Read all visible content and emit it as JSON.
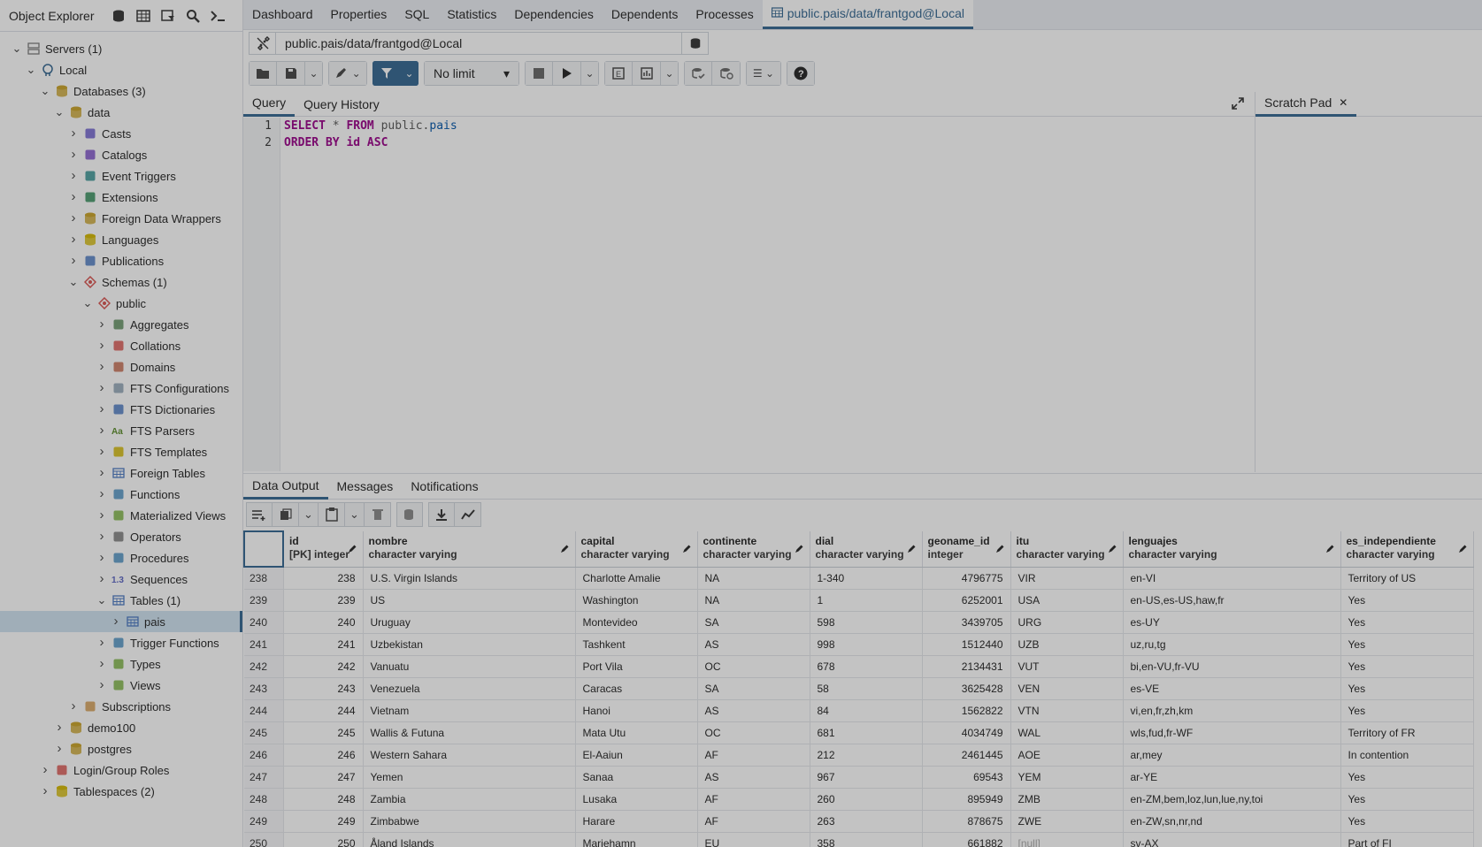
{
  "object_explorer": {
    "title": "Object Explorer",
    "tree": [
      {
        "label": "Servers (1)",
        "depth": 0,
        "expanded": true,
        "icon": "servers-icon"
      },
      {
        "label": "Local",
        "depth": 1,
        "expanded": true,
        "icon": "server-icon"
      },
      {
        "label": "Databases (3)",
        "depth": 2,
        "expanded": true,
        "icon": "databases-icon"
      },
      {
        "label": "data",
        "depth": 3,
        "expanded": true,
        "icon": "database-icon"
      },
      {
        "label": "Casts",
        "depth": 4,
        "expanded": false,
        "icon": "casts-icon"
      },
      {
        "label": "Catalogs",
        "depth": 4,
        "expanded": false,
        "icon": "catalogs-icon"
      },
      {
        "label": "Event Triggers",
        "depth": 4,
        "expanded": false,
        "icon": "event-triggers-icon"
      },
      {
        "label": "Extensions",
        "depth": 4,
        "expanded": false,
        "icon": "extensions-icon"
      },
      {
        "label": "Foreign Data Wrappers",
        "depth": 4,
        "expanded": false,
        "icon": "foreign-data-wrappers-icon"
      },
      {
        "label": "Languages",
        "depth": 4,
        "expanded": false,
        "icon": "languages-icon"
      },
      {
        "label": "Publications",
        "depth": 4,
        "expanded": false,
        "icon": "publications-icon"
      },
      {
        "label": "Schemas (1)",
        "depth": 4,
        "expanded": true,
        "icon": "schemas-icon"
      },
      {
        "label": "public",
        "depth": 5,
        "expanded": true,
        "icon": "schema-icon"
      },
      {
        "label": "Aggregates",
        "depth": 6,
        "expanded": false,
        "icon": "aggregates-icon"
      },
      {
        "label": "Collations",
        "depth": 6,
        "expanded": false,
        "icon": "collations-icon"
      },
      {
        "label": "Domains",
        "depth": 6,
        "expanded": false,
        "icon": "domains-icon"
      },
      {
        "label": "FTS Configurations",
        "depth": 6,
        "expanded": false,
        "icon": "fts-configurations-icon"
      },
      {
        "label": "FTS Dictionaries",
        "depth": 6,
        "expanded": false,
        "icon": "fts-dictionaries-icon"
      },
      {
        "label": "FTS Parsers",
        "depth": 6,
        "expanded": false,
        "icon": "fts-parsers-icon"
      },
      {
        "label": "FTS Templates",
        "depth": 6,
        "expanded": false,
        "icon": "fts-templates-icon"
      },
      {
        "label": "Foreign Tables",
        "depth": 6,
        "expanded": false,
        "icon": "foreign-tables-icon"
      },
      {
        "label": "Functions",
        "depth": 6,
        "expanded": false,
        "icon": "functions-icon"
      },
      {
        "label": "Materialized Views",
        "depth": 6,
        "expanded": false,
        "icon": "materialized-views-icon"
      },
      {
        "label": "Operators",
        "depth": 6,
        "expanded": false,
        "icon": "operators-icon"
      },
      {
        "label": "Procedures",
        "depth": 6,
        "expanded": false,
        "icon": "procedures-icon"
      },
      {
        "label": "Sequences",
        "depth": 6,
        "expanded": false,
        "icon": "sequences-icon"
      },
      {
        "label": "Tables (1)",
        "depth": 6,
        "expanded": true,
        "icon": "tables-icon"
      },
      {
        "label": "pais",
        "depth": 7,
        "expanded": false,
        "icon": "table-icon",
        "selected": true
      },
      {
        "label": "Trigger Functions",
        "depth": 6,
        "expanded": false,
        "icon": "trigger-functions-icon"
      },
      {
        "label": "Types",
        "depth": 6,
        "expanded": false,
        "icon": "types-icon"
      },
      {
        "label": "Views",
        "depth": 6,
        "expanded": false,
        "icon": "views-icon"
      },
      {
        "label": "Subscriptions",
        "depth": 4,
        "expanded": false,
        "icon": "subscriptions-icon"
      },
      {
        "label": "demo100",
        "depth": 3,
        "expanded": false,
        "icon": "database-icon"
      },
      {
        "label": "postgres",
        "depth": 3,
        "expanded": false,
        "icon": "database-icon"
      },
      {
        "label": "Login/Group Roles",
        "depth": 2,
        "expanded": false,
        "icon": "roles-icon"
      },
      {
        "label": "Tablespaces (2)",
        "depth": 2,
        "expanded": false,
        "icon": "tablespaces-icon"
      }
    ]
  },
  "main_tabs": [
    "Dashboard",
    "Properties",
    "SQL",
    "Statistics",
    "Dependencies",
    "Dependents",
    "Processes"
  ],
  "active_tab": "public.pais/data/frantgod@Local",
  "connection": "public.pais/data/frantgod@Local",
  "toolbar": {
    "limit": "No limit"
  },
  "query_tabs": {
    "query": "Query",
    "history": "Query History"
  },
  "scratch_pad": "Scratch Pad",
  "editor": {
    "lines": [
      {
        "n": "1",
        "tokens": [
          [
            "kw",
            "SELECT"
          ],
          [
            "id",
            " * "
          ],
          [
            "kw",
            "FROM"
          ],
          [
            "id",
            " public."
          ],
          [
            "tbl",
            "pais"
          ]
        ]
      },
      {
        "n": "2",
        "tokens": [
          [
            "kw",
            "ORDER BY"
          ],
          [
            "id",
            " "
          ],
          [
            "kw",
            "id ASC"
          ]
        ]
      }
    ]
  },
  "output_tabs": [
    "Data Output",
    "Messages",
    "Notifications"
  ],
  "grid": {
    "columns": [
      {
        "name": "id",
        "type": "[PK] integer",
        "width": 90
      },
      {
        "name": "nombre",
        "type": "character varying",
        "width": 240
      },
      {
        "name": "capital",
        "type": "character varying",
        "width": 138
      },
      {
        "name": "continente",
        "type": "character varying",
        "width": 127
      },
      {
        "name": "dial",
        "type": "character varying",
        "width": 127
      },
      {
        "name": "geoname_id",
        "type": "integer",
        "width": 100
      },
      {
        "name": "itu",
        "type": "character varying",
        "width": 127
      },
      {
        "name": "lenguajes",
        "type": "character varying",
        "width": 246
      },
      {
        "name": "es_independiente",
        "type": "character varying",
        "width": 150
      }
    ],
    "rows": [
      [
        "238",
        "238",
        "U.S. Virgin Islands",
        "Charlotte Amalie",
        "NA",
        "1-340",
        "4796775",
        "VIR",
        "en-VI",
        "Territory of US"
      ],
      [
        "239",
        "239",
        "US",
        "Washington",
        "NA",
        "1",
        "6252001",
        "USA",
        "en-US,es-US,haw,fr",
        "Yes"
      ],
      [
        "240",
        "240",
        "Uruguay",
        "Montevideo",
        "SA",
        "598",
        "3439705",
        "URG",
        "es-UY",
        "Yes"
      ],
      [
        "241",
        "241",
        "Uzbekistan",
        "Tashkent",
        "AS",
        "998",
        "1512440",
        "UZB",
        "uz,ru,tg",
        "Yes"
      ],
      [
        "242",
        "242",
        "Vanuatu",
        "Port Vila",
        "OC",
        "678",
        "2134431",
        "VUT",
        "bi,en-VU,fr-VU",
        "Yes"
      ],
      [
        "243",
        "243",
        "Venezuela",
        "Caracas",
        "SA",
        "58",
        "3625428",
        "VEN",
        "es-VE",
        "Yes"
      ],
      [
        "244",
        "244",
        "Vietnam",
        "Hanoi",
        "AS",
        "84",
        "1562822",
        "VTN",
        "vi,en,fr,zh,km",
        "Yes"
      ],
      [
        "245",
        "245",
        "Wallis & Futuna",
        "Mata Utu",
        "OC",
        "681",
        "4034749",
        "WAL",
        "wls,fud,fr-WF",
        "Territory of FR"
      ],
      [
        "246",
        "246",
        "Western Sahara",
        "El-Aaiun",
        "AF",
        "212",
        "2461445",
        "AOE",
        "ar,mey",
        "In contention"
      ],
      [
        "247",
        "247",
        "Yemen",
        "Sanaa",
        "AS",
        "967",
        "69543",
        "YEM",
        "ar-YE",
        "Yes"
      ],
      [
        "248",
        "248",
        "Zambia",
        "Lusaka",
        "AF",
        "260",
        "895949",
        "ZMB",
        "en-ZM,bem,loz,lun,lue,ny,toi",
        "Yes"
      ],
      [
        "249",
        "249",
        "Zimbabwe",
        "Harare",
        "AF",
        "263",
        "878675",
        "ZWE",
        "en-ZW,sn,nr,nd",
        "Yes"
      ],
      [
        "250",
        "250",
        "Åland Islands",
        "Mariehamn",
        "EU",
        "358",
        "661882",
        "[null]",
        "sv-AX",
        "Part of FI"
      ]
    ]
  }
}
